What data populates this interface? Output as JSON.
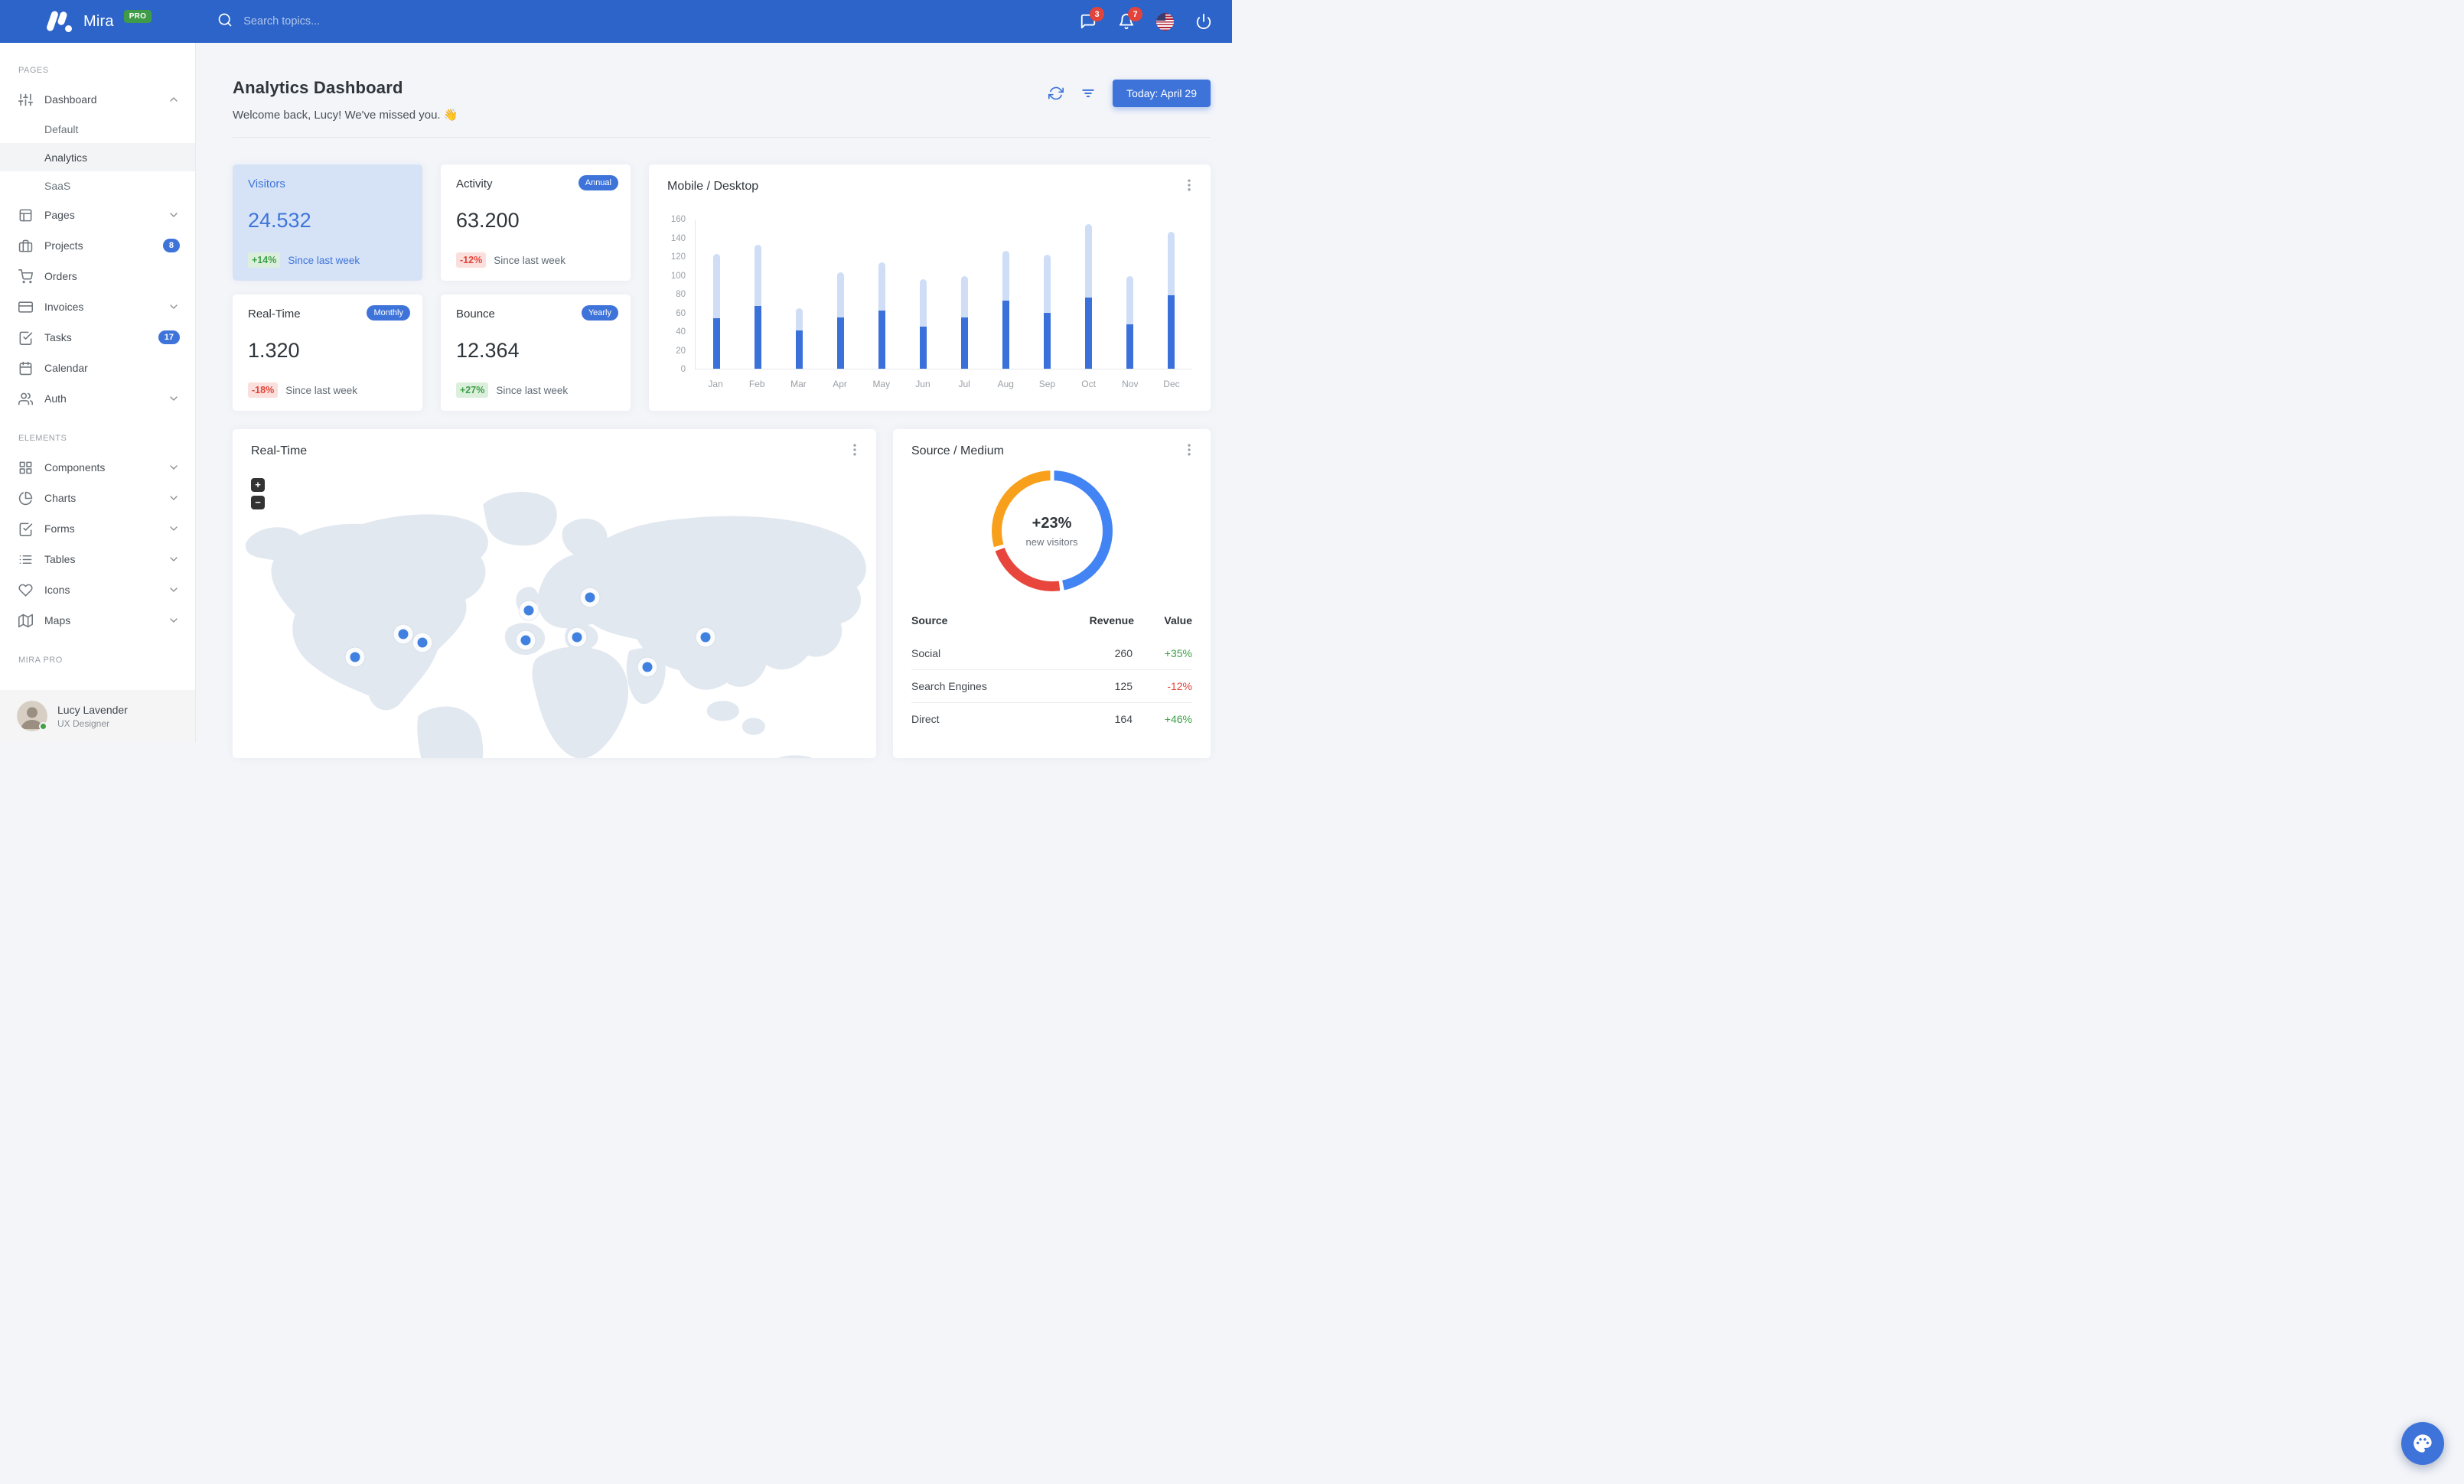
{
  "navbar": {
    "brand": "Mira",
    "brand_badge": "PRO",
    "search_placeholder": "Search topics...",
    "messages_badge": "3",
    "notifications_badge": "7"
  },
  "sidebar": {
    "sections": [
      {
        "label": "PAGES",
        "items": [
          {
            "id": "dashboard",
            "label": "Dashboard",
            "icon": "sliders",
            "chevron": "up",
            "children": [
              "Default",
              "Analytics",
              "SaaS"
            ],
            "active_child": "Analytics"
          },
          {
            "id": "pages",
            "label": "Pages",
            "icon": "layout",
            "chevron": "down"
          },
          {
            "id": "projects",
            "label": "Projects",
            "icon": "briefcase",
            "badge": "8"
          },
          {
            "id": "orders",
            "label": "Orders",
            "icon": "cart"
          },
          {
            "id": "invoices",
            "label": "Invoices",
            "icon": "credit-card",
            "chevron": "down"
          },
          {
            "id": "tasks",
            "label": "Tasks",
            "icon": "check-square",
            "badge": "17"
          },
          {
            "id": "calendar",
            "label": "Calendar",
            "icon": "calendar"
          },
          {
            "id": "auth",
            "label": "Auth",
            "icon": "users",
            "chevron": "down"
          }
        ]
      },
      {
        "label": "ELEMENTS",
        "items": [
          {
            "id": "components",
            "label": "Components",
            "icon": "grid",
            "chevron": "down"
          },
          {
            "id": "charts",
            "label": "Charts",
            "icon": "pie-chart",
            "chevron": "down"
          },
          {
            "id": "forms",
            "label": "Forms",
            "icon": "check-square",
            "chevron": "down"
          },
          {
            "id": "tables",
            "label": "Tables",
            "icon": "list",
            "chevron": "down"
          },
          {
            "id": "icons",
            "label": "Icons",
            "icon": "heart",
            "chevron": "down"
          },
          {
            "id": "maps",
            "label": "Maps",
            "icon": "map",
            "chevron": "down"
          }
        ]
      },
      {
        "label": "MIRA PRO",
        "items": []
      }
    ],
    "user": {
      "name": "Lucy Lavender",
      "role": "UX Designer",
      "status": "online"
    }
  },
  "page": {
    "title": "Analytics Dashboard",
    "welcome": "Welcome back, Lucy! We've missed you.",
    "wave_emoji": "👋",
    "date_button": "Today: April 29"
  },
  "stats": [
    {
      "title": "Visitors",
      "value": "24.532",
      "delta": "+14%",
      "trend": "up",
      "caption": "Since last week",
      "highlight": true
    },
    {
      "title": "Activity",
      "period_badge": "Annual",
      "value": "63.200",
      "delta": "-12%",
      "trend": "down",
      "caption": "Since last week",
      "highlight": false
    },
    {
      "title": "Real-Time",
      "period_badge": "Monthly",
      "value": "1.320",
      "delta": "-18%",
      "trend": "down",
      "caption": "Since last week",
      "highlight": false
    },
    {
      "title": "Bounce",
      "period_badge": "Yearly",
      "value": "12.364",
      "delta": "+27%",
      "trend": "up",
      "caption": "Since last week",
      "highlight": false
    }
  ],
  "chart_data": [
    {
      "type": "bar",
      "stacked": true,
      "title": "Mobile / Desktop",
      "categories": [
        "Jan",
        "Feb",
        "Mar",
        "Apr",
        "May",
        "Jun",
        "Jul",
        "Aug",
        "Sep",
        "Oct",
        "Nov",
        "Dec"
      ],
      "series": [
        {
          "name": "Mobile",
          "color": "#3a70d9",
          "values": [
            54,
            67,
            41,
            55,
            62,
            45,
            55,
            73,
            60,
            76,
            48,
            79
          ]
        },
        {
          "name": "Desktop",
          "color": "#cfdef6",
          "values": [
            69,
            66,
            24,
            48,
            52,
            51,
            44,
            53,
            62,
            79,
            51,
            68
          ]
        }
      ],
      "ylim": [
        0,
        160
      ],
      "yticks": [
        0,
        20,
        40,
        60,
        80,
        100,
        120,
        140,
        160
      ],
      "grid": false,
      "legend": "none",
      "xlabel": "",
      "ylabel": ""
    },
    {
      "type": "pie",
      "subtype": "donut",
      "title": "Source / Medium",
      "center_value": "+23%",
      "center_label": "new visitors",
      "slices": [
        {
          "label": "Social",
          "value": 260,
          "color": "#4384f4"
        },
        {
          "label": "Search Engines",
          "value": 125,
          "color": "#e8463c"
        },
        {
          "label": "Direct",
          "value": 164,
          "color": "#f8a01c"
        }
      ]
    }
  ],
  "map_panel": {
    "title": "Real-Time",
    "zoom_in": "+",
    "zoom_out": "−",
    "markers": [
      {
        "x": 19,
        "y": 56
      },
      {
        "x": 26.5,
        "y": 49
      },
      {
        "x": 29.5,
        "y": 51.5
      },
      {
        "x": 46,
        "y": 42
      },
      {
        "x": 45.5,
        "y": 51
      },
      {
        "x": 55.5,
        "y": 38
      },
      {
        "x": 53.5,
        "y": 50
      },
      {
        "x": 64.5,
        "y": 59
      },
      {
        "x": 73.5,
        "y": 50
      }
    ]
  },
  "source_panel": {
    "title": "Source / Medium",
    "table": {
      "headers": [
        "Source",
        "Revenue",
        "Value"
      ],
      "rows": [
        {
          "source": "Social",
          "revenue": "260",
          "value": "+35%",
          "trend": "up"
        },
        {
          "source": "Search Engines",
          "revenue": "125",
          "value": "-12%",
          "trend": "down"
        },
        {
          "source": "Direct",
          "revenue": "164",
          "value": "+46%",
          "trend": "up"
        }
      ]
    }
  },
  "colors": {
    "navbar": "#2d64c9",
    "primary": "#3e74d9",
    "success": "#3da047",
    "danger": "#e2453c",
    "page_bg": "#f3f5f9",
    "bar_mobile": "#3a70d9",
    "bar_desktop": "#cfdef6",
    "map_land": "#e2e8f0",
    "marker": "#4080e0"
  }
}
